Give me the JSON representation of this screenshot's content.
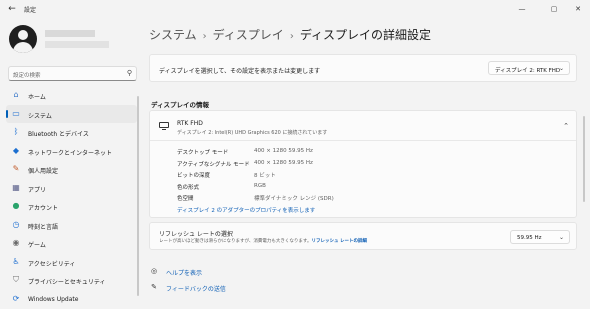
{
  "window": {
    "title": "設定",
    "back_icon": "←",
    "minimize": "—",
    "maximize": "▢",
    "close": "✕"
  },
  "sidebar": {
    "search_placeholder": "設定の検索",
    "items": [
      {
        "label": "ホーム",
        "icon": "home-icon",
        "glyph": "⌂",
        "color": "#3a78c9"
      },
      {
        "label": "システム",
        "icon": "system-icon",
        "glyph": "▭",
        "color": "#1f6fd1",
        "active": true
      },
      {
        "label": "Bluetooth とデバイス",
        "icon": "bluetooth-icon",
        "glyph": "ᛒ",
        "color": "#1f6fd1"
      },
      {
        "label": "ネットワークとインターネット",
        "icon": "wifi-icon",
        "glyph": "◆",
        "color": "#1c6fd0"
      },
      {
        "label": "個人用設定",
        "icon": "brush-icon",
        "glyph": "✎",
        "color": "#c15b2b"
      },
      {
        "label": "アプリ",
        "icon": "apps-icon",
        "glyph": "▦",
        "color": "#5a5f8a"
      },
      {
        "label": "アカウント",
        "icon": "account-icon",
        "glyph": "●",
        "color": "#2aa36b"
      },
      {
        "label": "時刻と言語",
        "icon": "globe-clock-icon",
        "glyph": "◷",
        "color": "#1f6fd1"
      },
      {
        "label": "ゲーム",
        "icon": "gamepad-icon",
        "glyph": "◉",
        "color": "#6b6b6b"
      },
      {
        "label": "アクセシビリティ",
        "icon": "accessibility-icon",
        "glyph": "♿",
        "color": "#1f6fd1"
      },
      {
        "label": "プライバシーとセキュリティ",
        "icon": "shield-icon",
        "glyph": "⛉",
        "color": "#6b6b6b"
      },
      {
        "label": "Windows Update",
        "icon": "update-icon",
        "glyph": "⟳",
        "color": "#1f6fd1"
      }
    ]
  },
  "breadcrumb": {
    "items": [
      "システム",
      "ディスプレイ"
    ],
    "current": "ディスプレイの詳細設定",
    "separator": "›"
  },
  "display_select": {
    "label": "ディスプレイを選択して、その設定を表示または変更します",
    "value": "ディスプレイ 2: RTK FHD"
  },
  "info": {
    "section_title": "ディスプレイの情報",
    "name": "RTK FHD",
    "subtitle": "ディスプレイ 2: Intel(R) UHD Graphics 620 に接続されています",
    "rows": [
      {
        "key": "デスクトップ モード",
        "value": "400 × 1280 59.95 Hz"
      },
      {
        "key": "アクティブなシグナル モード",
        "value": "400 × 1280 59.95 Hz"
      },
      {
        "key": "ビットの深度",
        "value": "8 ビット"
      },
      {
        "key": "色の形式",
        "value": "RGB"
      },
      {
        "key": "色空間",
        "value": "標準ダイナミック レンジ (SDR)"
      }
    ],
    "adapter_link": "ディスプレイ 2 のアダプターのプロパティを表示します"
  },
  "refresh": {
    "title": "リフレッシュ レートの選択",
    "description": "レートが高いほど動きは滑らかになりますが、消費電力も大きくなります。",
    "link": "リフレッシュ レートの詳細",
    "value": "59.95 Hz"
  },
  "help": {
    "get_help": "ヘルプを表示",
    "feedback": "フィードバックの送信"
  }
}
